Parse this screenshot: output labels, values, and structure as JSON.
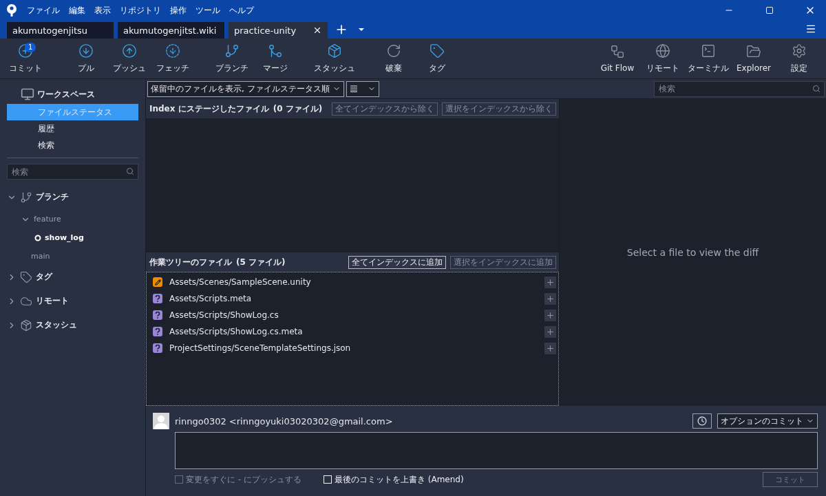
{
  "menu": [
    "ファイル",
    "編集",
    "表示",
    "リポジトリ",
    "操作",
    "ツール",
    "ヘルプ"
  ],
  "tabs": [
    {
      "label": "akumutogenjitsu",
      "selected": false
    },
    {
      "label": "akumutogenjitst.wiki",
      "selected": false
    },
    {
      "label": "practice-unity",
      "selected": true
    }
  ],
  "toolbar": {
    "left": [
      {
        "kind": "commit",
        "label": "コミット",
        "badge": "1"
      },
      {
        "kind": "pull",
        "label": "プル"
      },
      {
        "kind": "push",
        "label": "プッシュ"
      },
      {
        "kind": "fetch",
        "label": "フェッチ"
      },
      {
        "kind": "branch",
        "label": "ブランチ"
      },
      {
        "kind": "merge",
        "label": "マージ"
      },
      {
        "kind": "stash",
        "label": "スタッシュ"
      },
      {
        "kind": "discard",
        "label": "破棄"
      },
      {
        "kind": "tag",
        "label": "タグ"
      }
    ],
    "right": [
      {
        "kind": "gitflow",
        "label": "Git Flow"
      },
      {
        "kind": "remote",
        "label": "リモート"
      },
      {
        "kind": "terminal",
        "label": "ターミナル"
      },
      {
        "kind": "explorer",
        "label": "Explorer"
      },
      {
        "kind": "settings",
        "label": "設定"
      }
    ]
  },
  "sidebar": {
    "workspace": "ワークスペース",
    "items": [
      {
        "label": "ファイルステータス",
        "selected": true
      },
      {
        "label": "履歴",
        "selected": false
      },
      {
        "label": "検索",
        "selected": false
      }
    ],
    "search": {
      "placeholder": "検索"
    },
    "sections": [
      {
        "kind": "branch",
        "label": "ブランチ",
        "expanded": true,
        "children": [
          {
            "label": "feature",
            "expanded": true,
            "children": [
              {
                "label": "show_log",
                "current": true
              }
            ]
          },
          {
            "label": "main",
            "current": false
          }
        ]
      },
      {
        "kind": "tag",
        "label": "タグ",
        "expanded": false
      },
      {
        "kind": "remote",
        "label": "リモート",
        "expanded": false
      },
      {
        "kind": "stash",
        "label": "スタッシュ",
        "expanded": false
      }
    ]
  },
  "filter": {
    "value": "保留中のファイルを表示, ファイルステータス順"
  },
  "search": {
    "placeholder": "検索"
  },
  "staged": {
    "title": "Index にステージしたファイル",
    "count": "(0 ファイル)",
    "buttons": [
      {
        "label": "全てインデックスから除く",
        "disabled": true
      },
      {
        "label": "選択をインデックスから除く",
        "disabled": true
      }
    ]
  },
  "unstaged": {
    "title": "作業ツリーのファイル",
    "count": "(5 ファイル)",
    "buttons": [
      {
        "label": "全てインデックスに追加",
        "disabled": false
      },
      {
        "label": "選択をインデックスに追加",
        "disabled": true
      }
    ],
    "files": [
      {
        "path": "Assets/Scenes/SampleScene.unity",
        "kind": "modified"
      },
      {
        "path": "Assets/Scripts.meta",
        "kind": "untracked"
      },
      {
        "path": "Assets/Scripts/ShowLog.cs",
        "kind": "untracked"
      },
      {
        "path": "Assets/Scripts/ShowLog.cs.meta",
        "kind": "untracked"
      },
      {
        "path": "ProjectSettings/SceneTemplateSettings.json",
        "kind": "untracked"
      }
    ]
  },
  "diff": {
    "message": "Select a file to view the diff"
  },
  "commit": {
    "author": "rinngo0302 <rinngoyuki03020302@gmail.com>",
    "options": "オプションのコミット",
    "checkboxes": [
      {
        "label": "変更をすぐに - にプッシュする",
        "checked": false,
        "disabled": true
      },
      {
        "label": "最後のコミットを上書き (Amend)",
        "checked": false,
        "disabled": false
      }
    ],
    "button": {
      "label": "コミット",
      "disabled": true
    }
  }
}
